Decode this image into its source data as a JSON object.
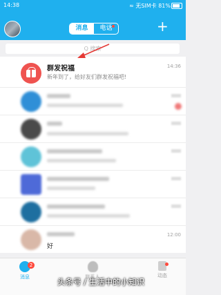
{
  "status": {
    "time": "14:38",
    "right": "≈ 无SIM卡 81%"
  },
  "header": {
    "tabs": [
      "消息",
      "电话"
    ],
    "plus": "+",
    "search_placeholder": "Q 搜索"
  },
  "conversations": [
    {
      "name": "群发祝福",
      "preview": "新年到了，给好友们群发祝福吧!",
      "time": "14:36",
      "icon": "gift-icon"
    },
    {
      "name": "",
      "preview": "",
      "time": "",
      "blurred": true,
      "avatar_color": "#2f8fd7"
    },
    {
      "name": "",
      "preview": "赏品牌的小...",
      "preview_partial": "靠嘉品牌的",
      "time": "",
      "blurred": true,
      "avatar_color": "#4a4a4a"
    },
    {
      "name": "",
      "preview": "",
      "time": "",
      "blurred": true,
      "avatar_color": "#5fc3d8"
    },
    {
      "name": "",
      "preview": "",
      "time": "",
      "blurred": true,
      "avatar_color": "#4e6ad8"
    },
    {
      "name": "",
      "preview": "",
      "time": "",
      "blurred": true,
      "avatar_color": "#1e6fa0"
    },
    {
      "name": "",
      "preview": "好",
      "time": "12:00",
      "blurred": true,
      "avatar_color": "#d9b8a8"
    }
  ],
  "bottom_nav": {
    "tabs": [
      {
        "label": "消息",
        "icon": "chat-icon",
        "badge": "2"
      },
      {
        "label": "联系人",
        "icon": "contacts-icon"
      },
      {
        "label": "动态",
        "icon": "star-icon"
      }
    ]
  },
  "watermark": "头条号 / 生活中的小知识",
  "colors": {
    "brand": "#1fb0ee",
    "alert": "#ff4a3d",
    "gift": "#ef5350"
  }
}
